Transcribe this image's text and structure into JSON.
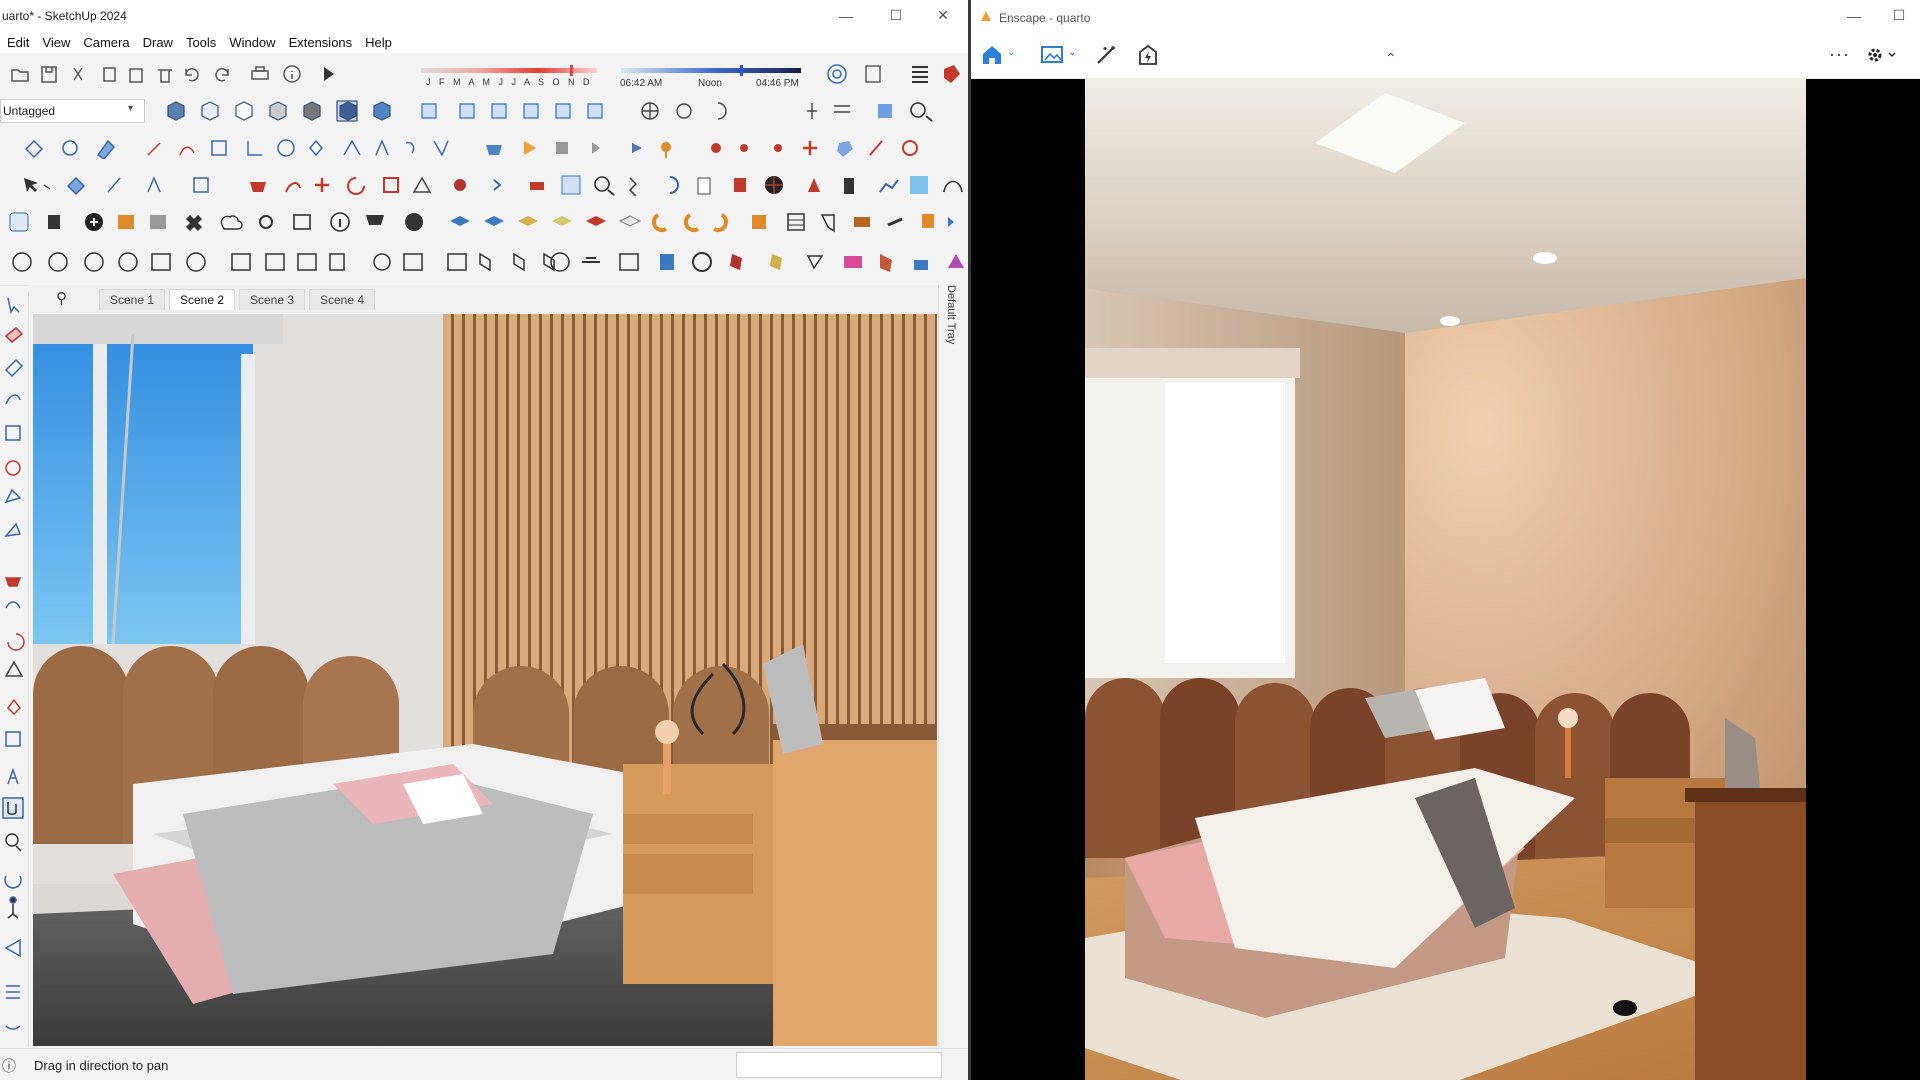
{
  "sketchup": {
    "title": "uarto* - SketchUp 2024",
    "menu": [
      "Edit",
      "View",
      "Camera",
      "Draw",
      "Tools",
      "Window",
      "Extensions",
      "Help"
    ],
    "tag_select": "Untagged",
    "shadow_months": "J F M A M J J A S O N D",
    "time_start": "06:42 AM",
    "time_mid": "Noon",
    "time_end": "04:46 PM",
    "scenes": [
      "Scene 1",
      "Scene 2",
      "Scene 3",
      "Scene 4"
    ],
    "active_scene": "Scene 2",
    "tray_label": "Default Tray",
    "status_text": "Drag in direction to pan",
    "colors": {
      "accent": "#2b7fd4",
      "toolbar": "#f3f3f3"
    }
  },
  "enscape": {
    "title": "Enscape - quarto",
    "icons": [
      "home-icon",
      "image-icon",
      "magic-wand-icon",
      "lightning-icon",
      "more-icon",
      "settings-icon"
    ],
    "more_label": "···"
  },
  "window_controls": {
    "minimize": "—",
    "maximize": "☐",
    "close": "✕"
  }
}
